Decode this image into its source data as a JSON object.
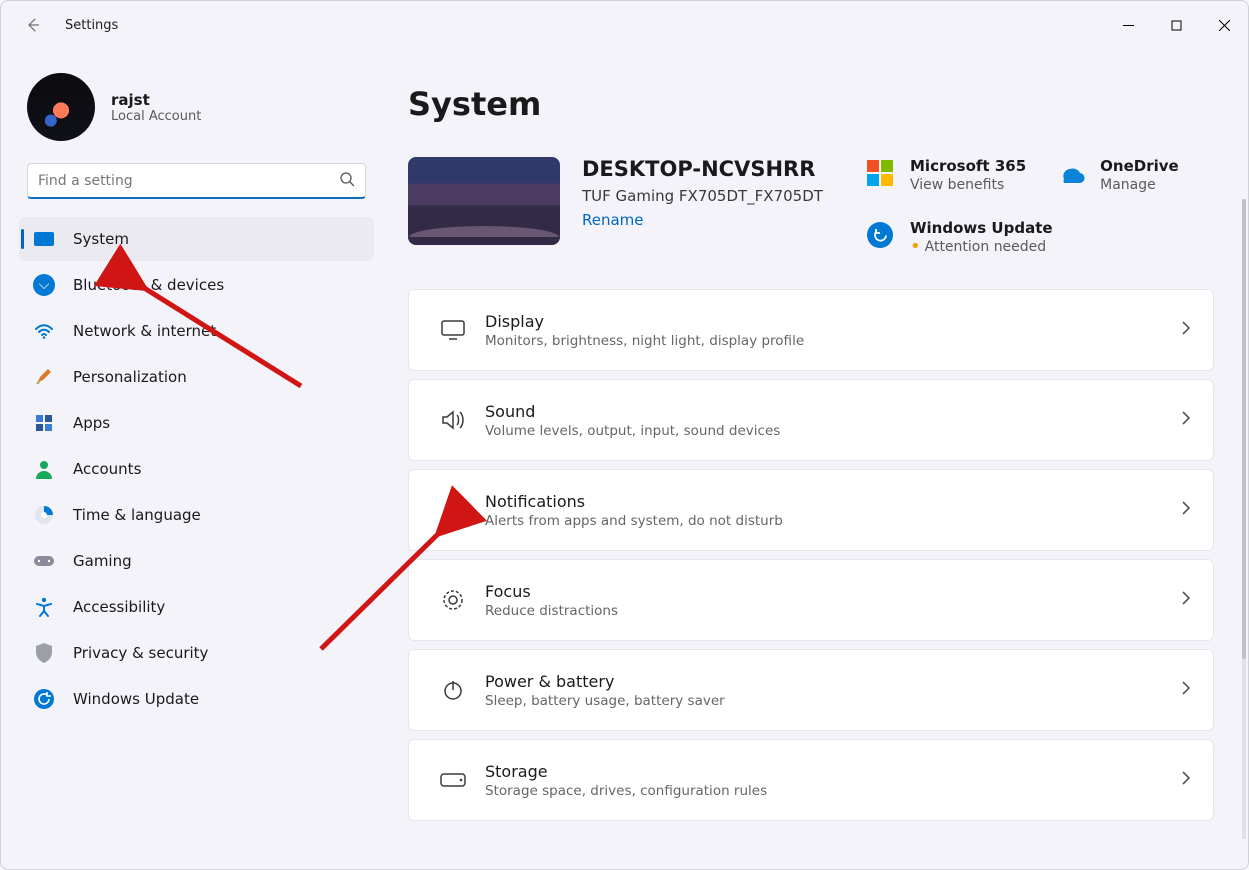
{
  "app": {
    "title": "Settings"
  },
  "user": {
    "name": "rajst",
    "account_type": "Local Account"
  },
  "search": {
    "placeholder": "Find a setting"
  },
  "nav": {
    "system": "System",
    "bluetooth": "Bluetooth & devices",
    "network": "Network & internet",
    "personalization": "Personalization",
    "apps": "Apps",
    "accounts": "Accounts",
    "time": "Time & language",
    "gaming": "Gaming",
    "accessibility": "Accessibility",
    "privacy": "Privacy & security",
    "windows_update": "Windows Update"
  },
  "page": {
    "heading": "System",
    "device_name": "DESKTOP-NCVSHRR",
    "device_model": "TUF Gaming FX705DT_FX705DT",
    "rename": "Rename"
  },
  "promo": {
    "m365_title": "Microsoft 365",
    "m365_sub": "View benefits",
    "onedrive_title": "OneDrive",
    "onedrive_sub": "Manage",
    "wu_title": "Windows Update",
    "wu_sub": "Attention needed"
  },
  "cards": {
    "display": {
      "title": "Display",
      "sub": "Monitors, brightness, night light, display profile"
    },
    "sound": {
      "title": "Sound",
      "sub": "Volume levels, output, input, sound devices"
    },
    "notifications": {
      "title": "Notifications",
      "sub": "Alerts from apps and system, do not disturb"
    },
    "focus": {
      "title": "Focus",
      "sub": "Reduce distractions"
    },
    "power": {
      "title": "Power & battery",
      "sub": "Sleep, battery usage, battery saver"
    },
    "storage": {
      "title": "Storage",
      "sub": "Storage space, drives, configuration rules"
    }
  }
}
